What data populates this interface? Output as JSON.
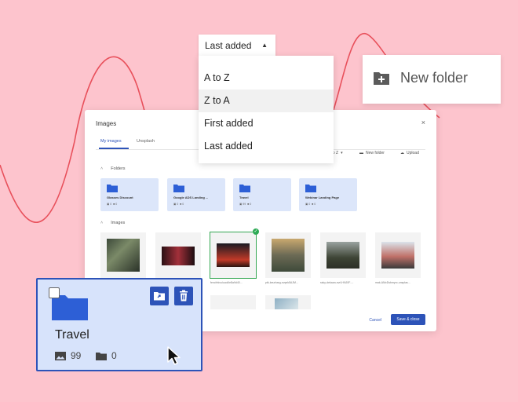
{
  "dialog": {
    "title": "Images",
    "close_label": "×",
    "tabs": [
      {
        "label": "My images"
      },
      {
        "label": "Unsplash"
      }
    ],
    "sort_value": "A to Z",
    "new_folder_label": "New folder",
    "upload_label": "Upload",
    "folders_heading": "Folders",
    "images_heading": "Images",
    "folders": [
      {
        "name": "Glasses Discount",
        "images": "0",
        "folders": "0"
      },
      {
        "name": "Google ADS Landing ...",
        "images": "0",
        "folders": "0"
      },
      {
        "name": "Travel",
        "images": "99",
        "folders": "0"
      },
      {
        "name": "Webinar Landing Page",
        "images": "0",
        "folders": "0"
      }
    ],
    "images": [
      {
        "caption": "",
        "color": "#4f5a44"
      },
      {
        "caption": "",
        "color": "#6b1d23"
      },
      {
        "caption": "fenchhivuiuuoli/e8a9d40...",
        "color": "#2f1a19"
      },
      {
        "caption": "ptk-keurbarg-zvqek5AJM...",
        "color": "#7b6a52"
      },
      {
        "caption": "ssky-dekaan-svrLHNJ0F-...",
        "color": "#4a4e3d"
      },
      {
        "caption": "mak-AMcDsbmyrc-unsplas...",
        "color": "#b3665f"
      }
    ],
    "cancel_label": "Cancel",
    "save_label": "Save & close"
  },
  "sort_dropdown": {
    "selected": "Last added",
    "options": [
      {
        "label": "A to Z"
      },
      {
        "label": "Z to A"
      },
      {
        "label": "First added"
      },
      {
        "label": "Last added"
      }
    ],
    "highlighted_index": 1
  },
  "new_folder_popup": {
    "label": "New folder"
  },
  "travel_card": {
    "name": "Travel",
    "images_count": "99",
    "folders_count": "0"
  },
  "colors": {
    "background": "#fdc4cd",
    "accent": "#2d53b8",
    "folder_bg": "#dce6fa",
    "curve": "#e8505b",
    "check": "#2eaa55"
  }
}
